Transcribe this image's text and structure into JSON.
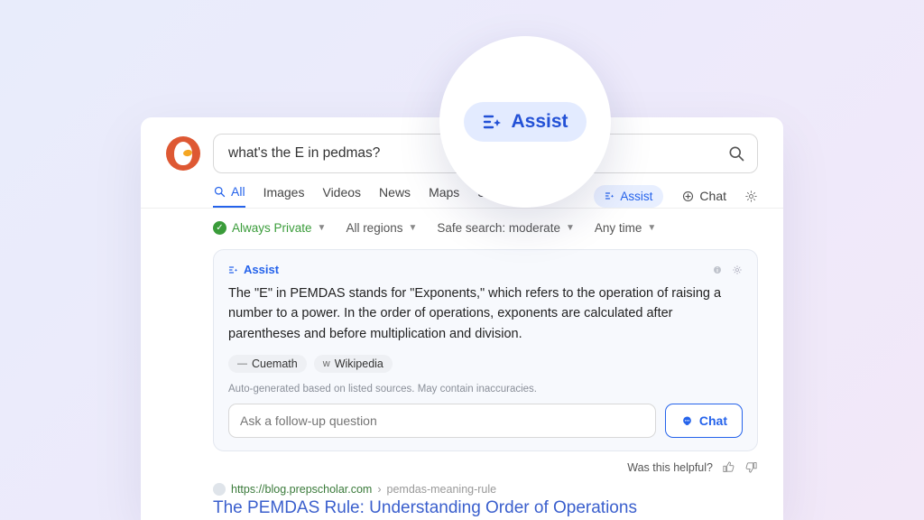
{
  "search": {
    "query": "what's the E in pedmas?"
  },
  "tabs": {
    "all": "All",
    "images": "Images",
    "videos": "Videos",
    "news": "News",
    "maps": "Maps",
    "shopping": "Shopping"
  },
  "nav": {
    "assist": "Assist",
    "chat": "Chat"
  },
  "filters": {
    "privacy": "Always Private",
    "region": "All regions",
    "safe": "Safe search: moderate",
    "time": "Any time"
  },
  "assist": {
    "label": "Assist",
    "body": "The \"E\" in PEMDAS stands for \"Exponents,\" which refers to the operation of raising a number to a power. In the order of operations, exponents are calculated after parentheses and before multiplication and division.",
    "sources": [
      {
        "icon": "—",
        "name": "Cuemath"
      },
      {
        "icon": "w",
        "name": "Wikipedia"
      }
    ],
    "disclaimer": "Auto-generated based on listed sources. May contain inaccuracies.",
    "follow_placeholder": "Ask a follow-up question",
    "chat_btn": "Chat",
    "helpful_label": "Was this helpful?"
  },
  "result": {
    "host": "https://blog.prepscholar.com",
    "path": "pemdas-meaning-rule",
    "title": "The PEMDAS Rule: Understanding Order of Operations"
  },
  "callout": {
    "label": "Assist"
  }
}
